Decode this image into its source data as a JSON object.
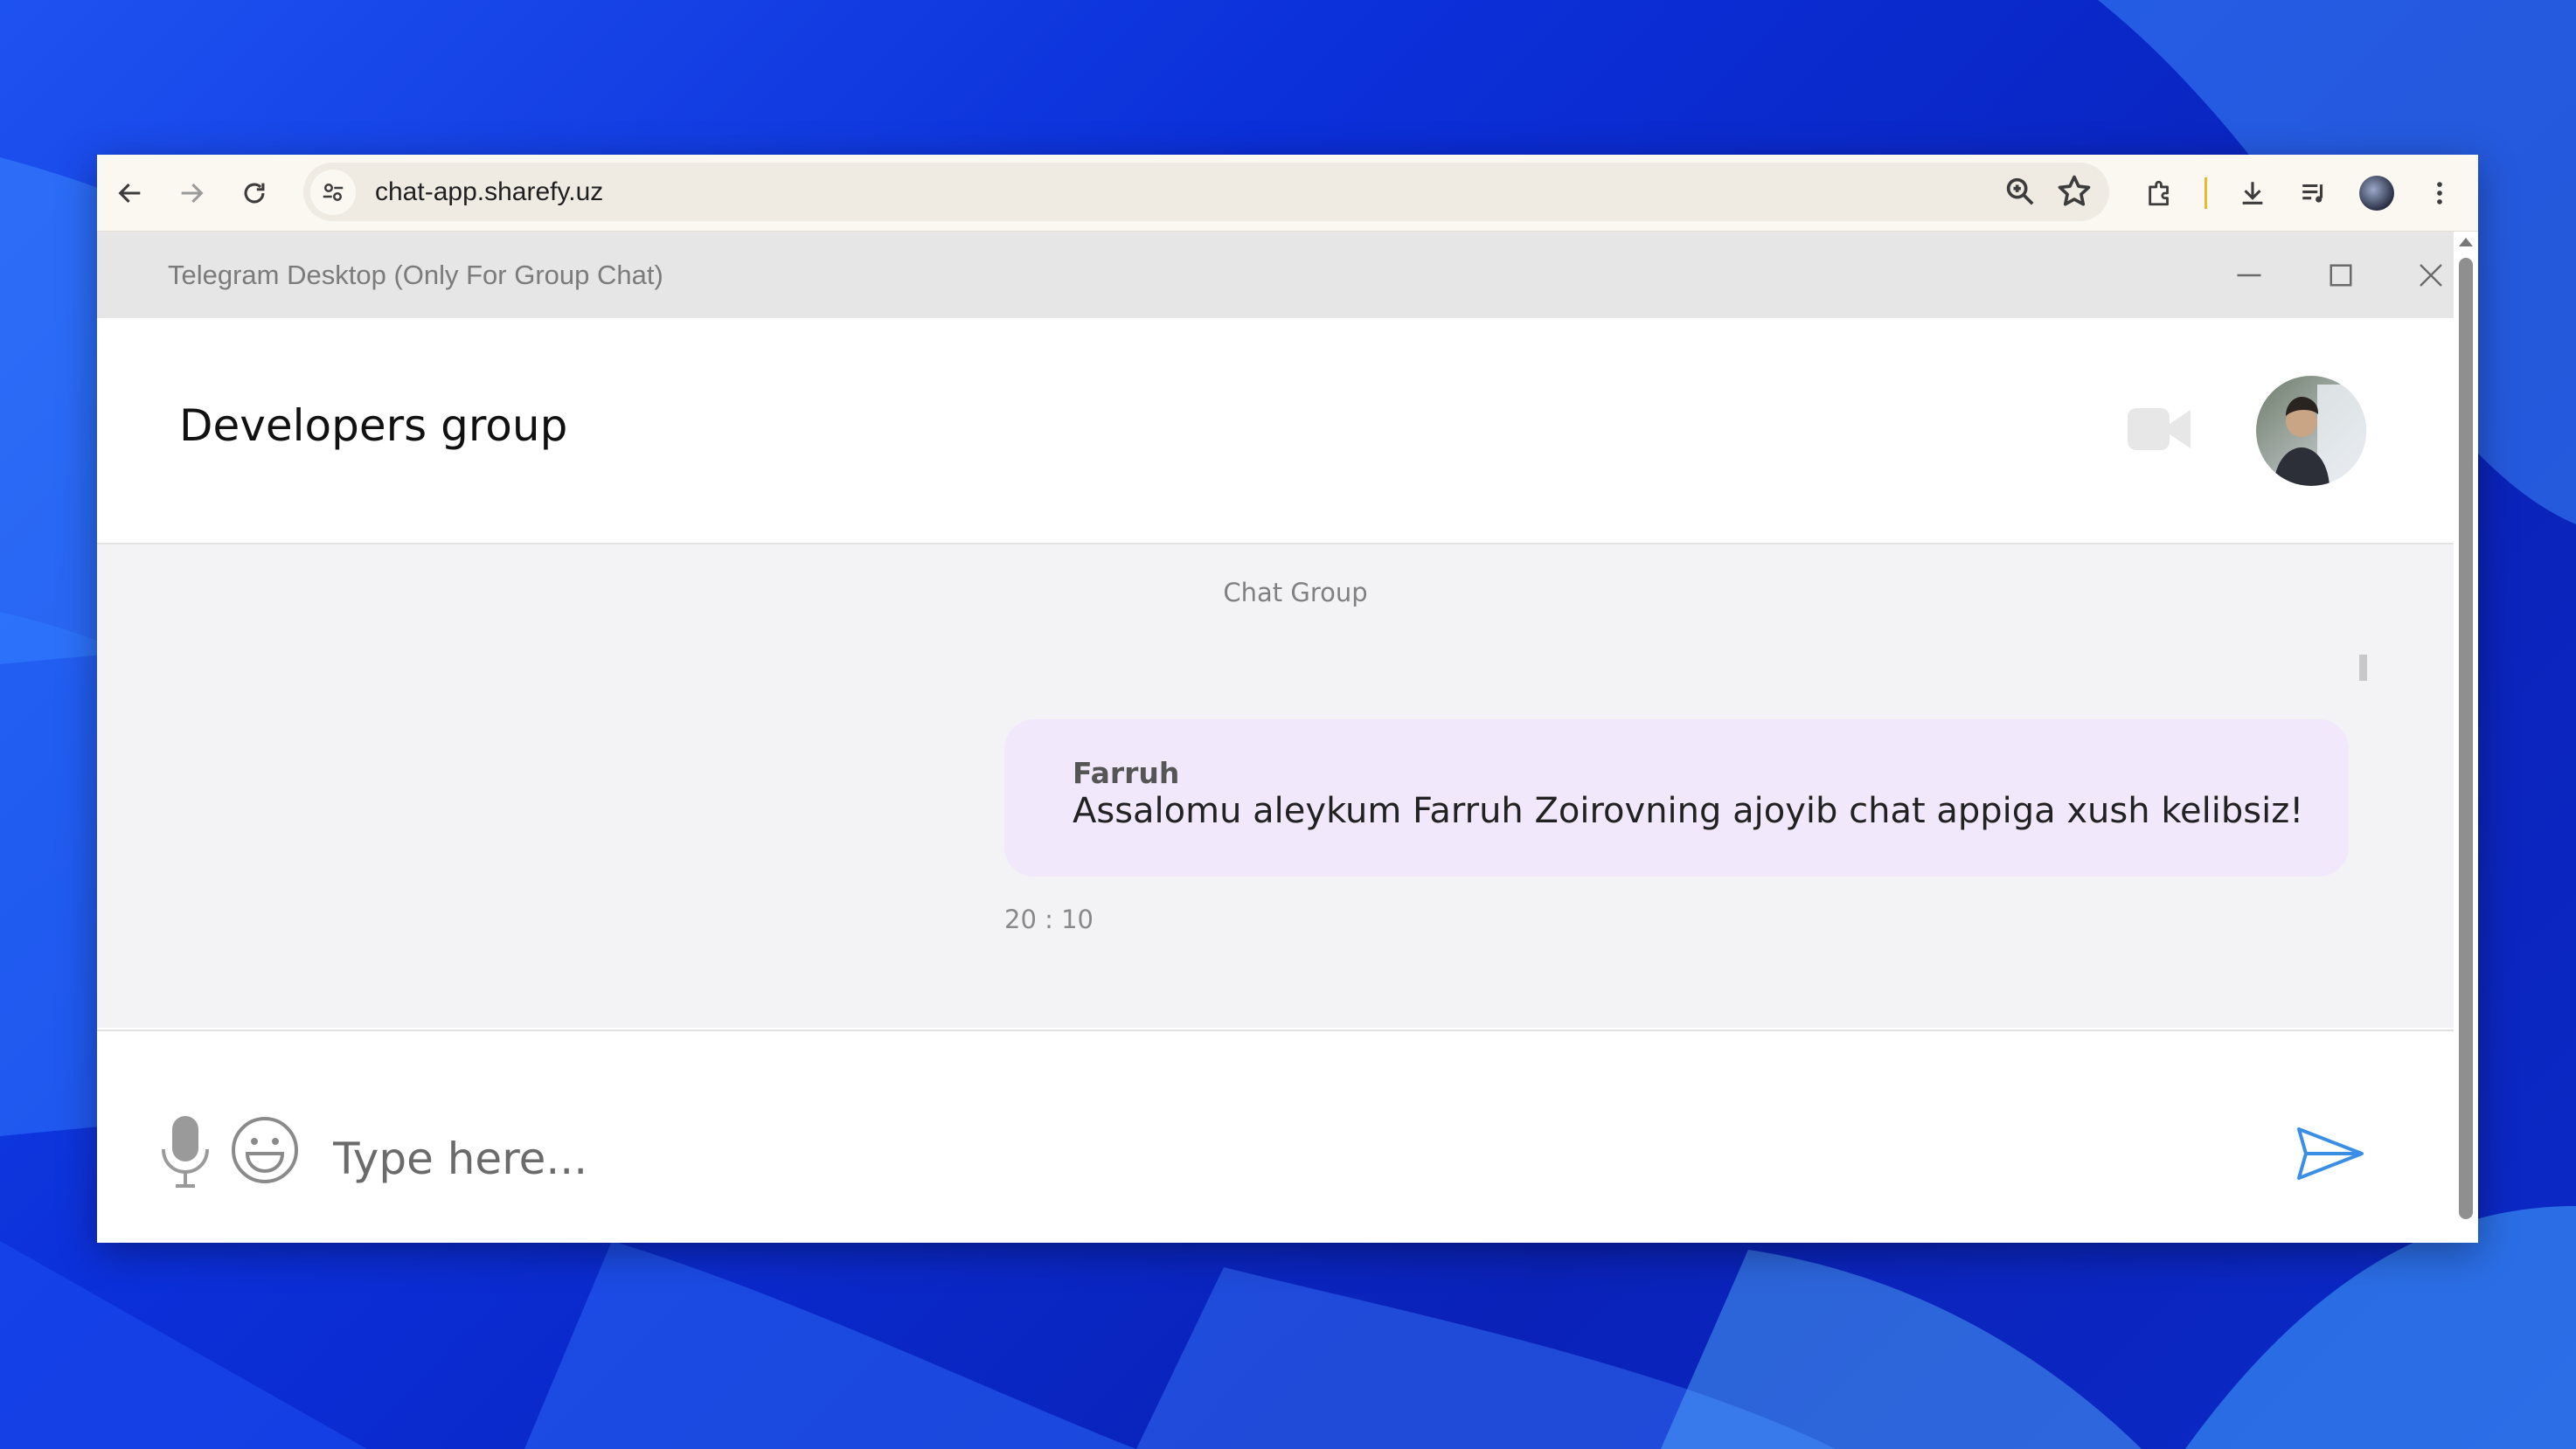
{
  "browser": {
    "url": "chat-app.sharefy.uz",
    "icons": [
      "back-icon",
      "forward-icon",
      "reload-icon",
      "site-info-icon",
      "zoom-icon",
      "star-icon",
      "extensions-icon",
      "download-icon",
      "media-control-icon",
      "profile-icon",
      "more-icon"
    ]
  },
  "app": {
    "window_title": "Telegram Desktop (Only For Group Chat)",
    "group_name": "Developers group",
    "date_label": "Chat Group"
  },
  "messages": [
    {
      "sender": "Farruh",
      "text": "Assalomu aleykum Farruh Zoirovning ajoyib chat appiga xush kelibsiz!",
      "time": "20 : 10",
      "color": "#f1e9fb"
    }
  ],
  "composer": {
    "placeholder": "Type here...",
    "icons": [
      "microphone-icon",
      "emoji-icon",
      "send-icon"
    ]
  },
  "colors": {
    "accent": "#3a8ee6",
    "bubble": "#f1e9fb",
    "messages_bg": "#f3f3f6",
    "titlebar_bg": "#e6e6e6"
  }
}
